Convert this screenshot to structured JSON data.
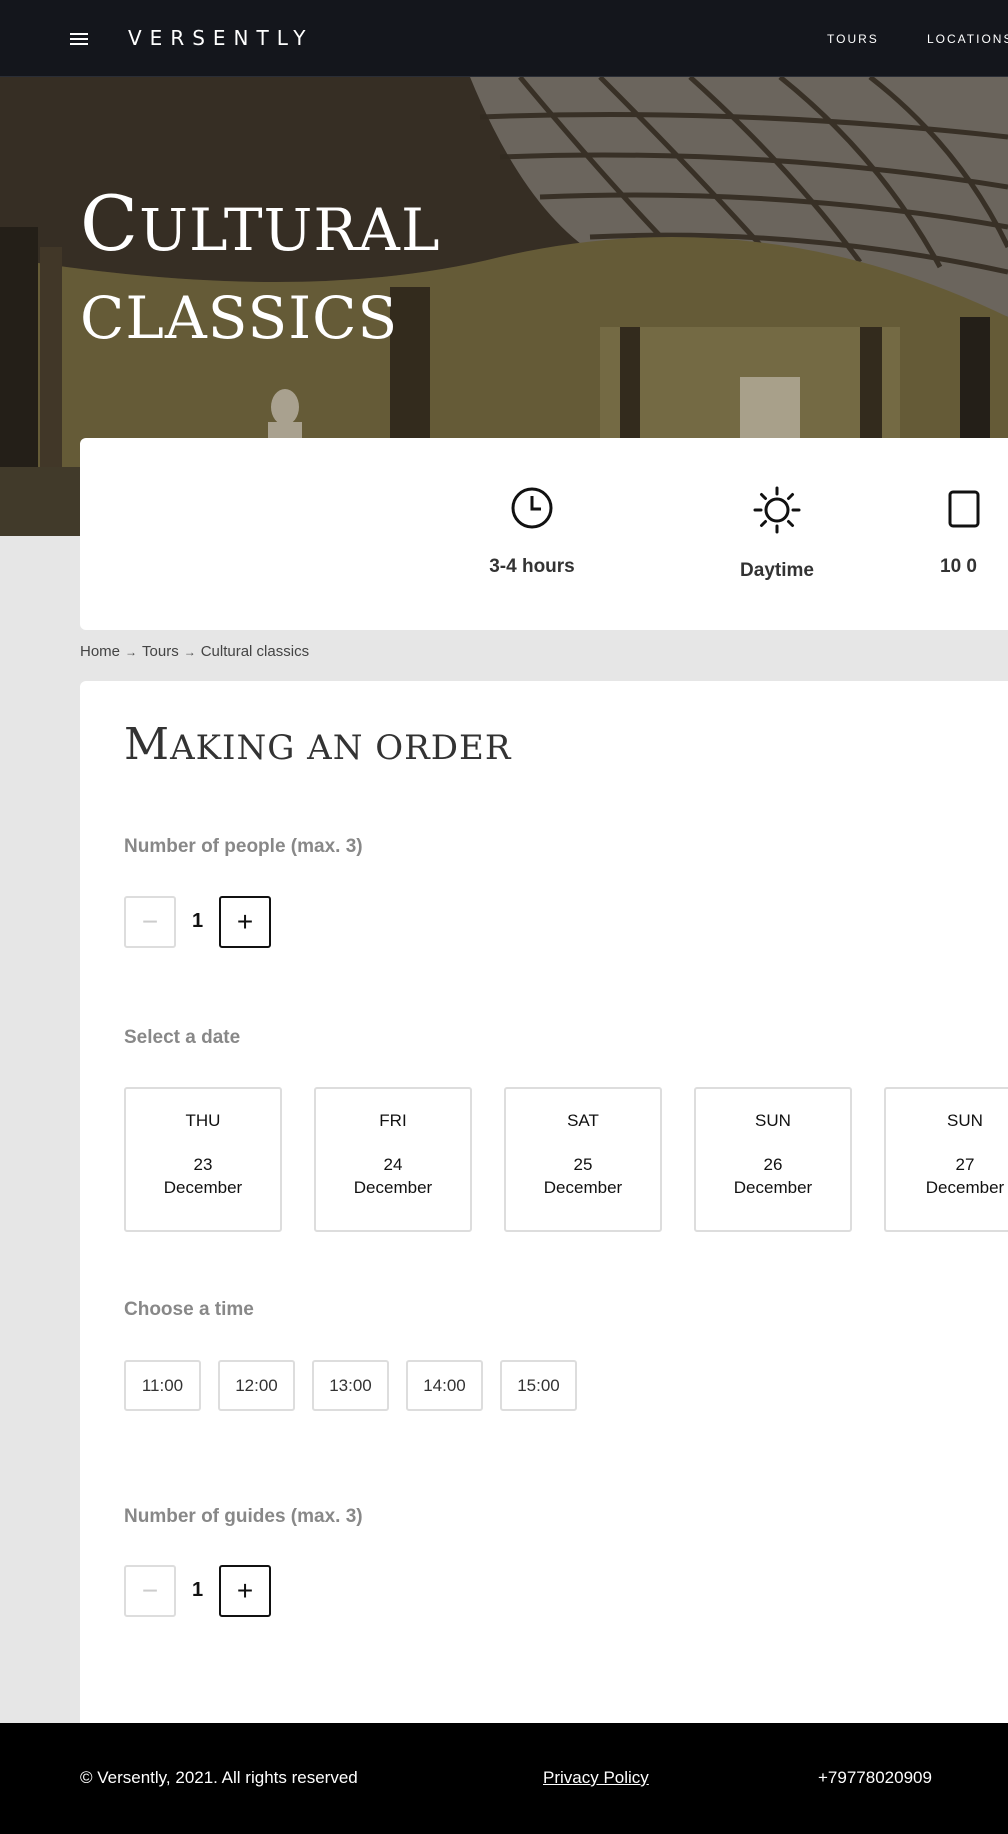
{
  "header": {
    "logo": "VERSENTLY",
    "nav": [
      {
        "label": "TOURS"
      },
      {
        "label": "LOCATIONS"
      }
    ]
  },
  "hero": {
    "title_line1_cap": "C",
    "title_line1_rest": "ULTURAL",
    "title_line2": "CLASSICS"
  },
  "info": [
    {
      "icon": "clock-icon",
      "label": "3-4 hours"
    },
    {
      "icon": "sun-icon",
      "label": "Daytime"
    },
    {
      "icon": "calendar-icon",
      "label": "10 0"
    }
  ],
  "breadcrumb": {
    "items": [
      "Home",
      "Tours",
      "Cultural classics"
    ],
    "separator": "→"
  },
  "order": {
    "title_cap": "M",
    "title_rest": "AKING AN ORDER",
    "people": {
      "label": "Number of people (max. 3)",
      "value": "1",
      "minus": "−",
      "plus": "+"
    },
    "date": {
      "label": "Select a date",
      "options": [
        {
          "day": "THU",
          "num": "23",
          "month": "December"
        },
        {
          "day": "FRI",
          "num": "24",
          "month": "December"
        },
        {
          "day": "SAT",
          "num": "25",
          "month": "December"
        },
        {
          "day": "SUN",
          "num": "26",
          "month": "December"
        },
        {
          "day": "SUN",
          "num": "27",
          "month": "December"
        }
      ]
    },
    "time": {
      "label": "Choose a time",
      "options": [
        "11:00",
        "12:00",
        "13:00",
        "14:00",
        "15:00"
      ]
    },
    "guides": {
      "label": "Number of guides (max. 3)",
      "value": "1",
      "minus": "−",
      "plus": "+"
    }
  },
  "footer": {
    "copyright": "© Versently, 2021. All rights reserved",
    "privacy": "Privacy Policy",
    "phone": "+79778020909"
  }
}
